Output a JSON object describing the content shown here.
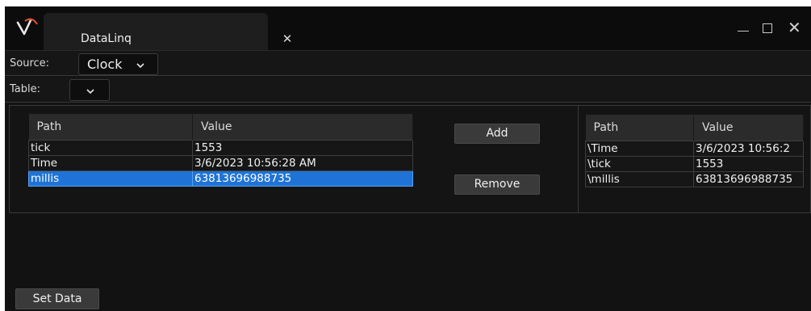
{
  "window": {
    "tab_title": "DataLinq",
    "tab_close_icon": "close-icon",
    "controls": [
      "minimize-icon",
      "maximize-icon",
      "close-icon"
    ]
  },
  "source": {
    "label": "Source:",
    "value": "Clock"
  },
  "table": {
    "label": "Table:",
    "value": ""
  },
  "left_grid": {
    "columns": [
      "Path",
      "Value"
    ],
    "rows": [
      {
        "path": "tick",
        "value": "1553"
      },
      {
        "path": "Time",
        "value": "3/6/2023 10:56:28 AM"
      },
      {
        "path": "millis",
        "value": "63813696988735"
      }
    ],
    "selected_row": "millis"
  },
  "actions": {
    "add": "Add",
    "remove": "Remove",
    "set_data": "Set Data"
  },
  "right_grid": {
    "columns": [
      "Path",
      "Value"
    ],
    "rows": [
      {
        "path": "\\Time",
        "value": "3/6/2023 10:56:2"
      },
      {
        "path": "\\tick",
        "value": "1553"
      },
      {
        "path": "\\millis",
        "value": "63813696988735"
      }
    ]
  },
  "colors": {
    "background": "#121212",
    "selection": "#1f73d6",
    "logo_accent": "#e2542b"
  }
}
